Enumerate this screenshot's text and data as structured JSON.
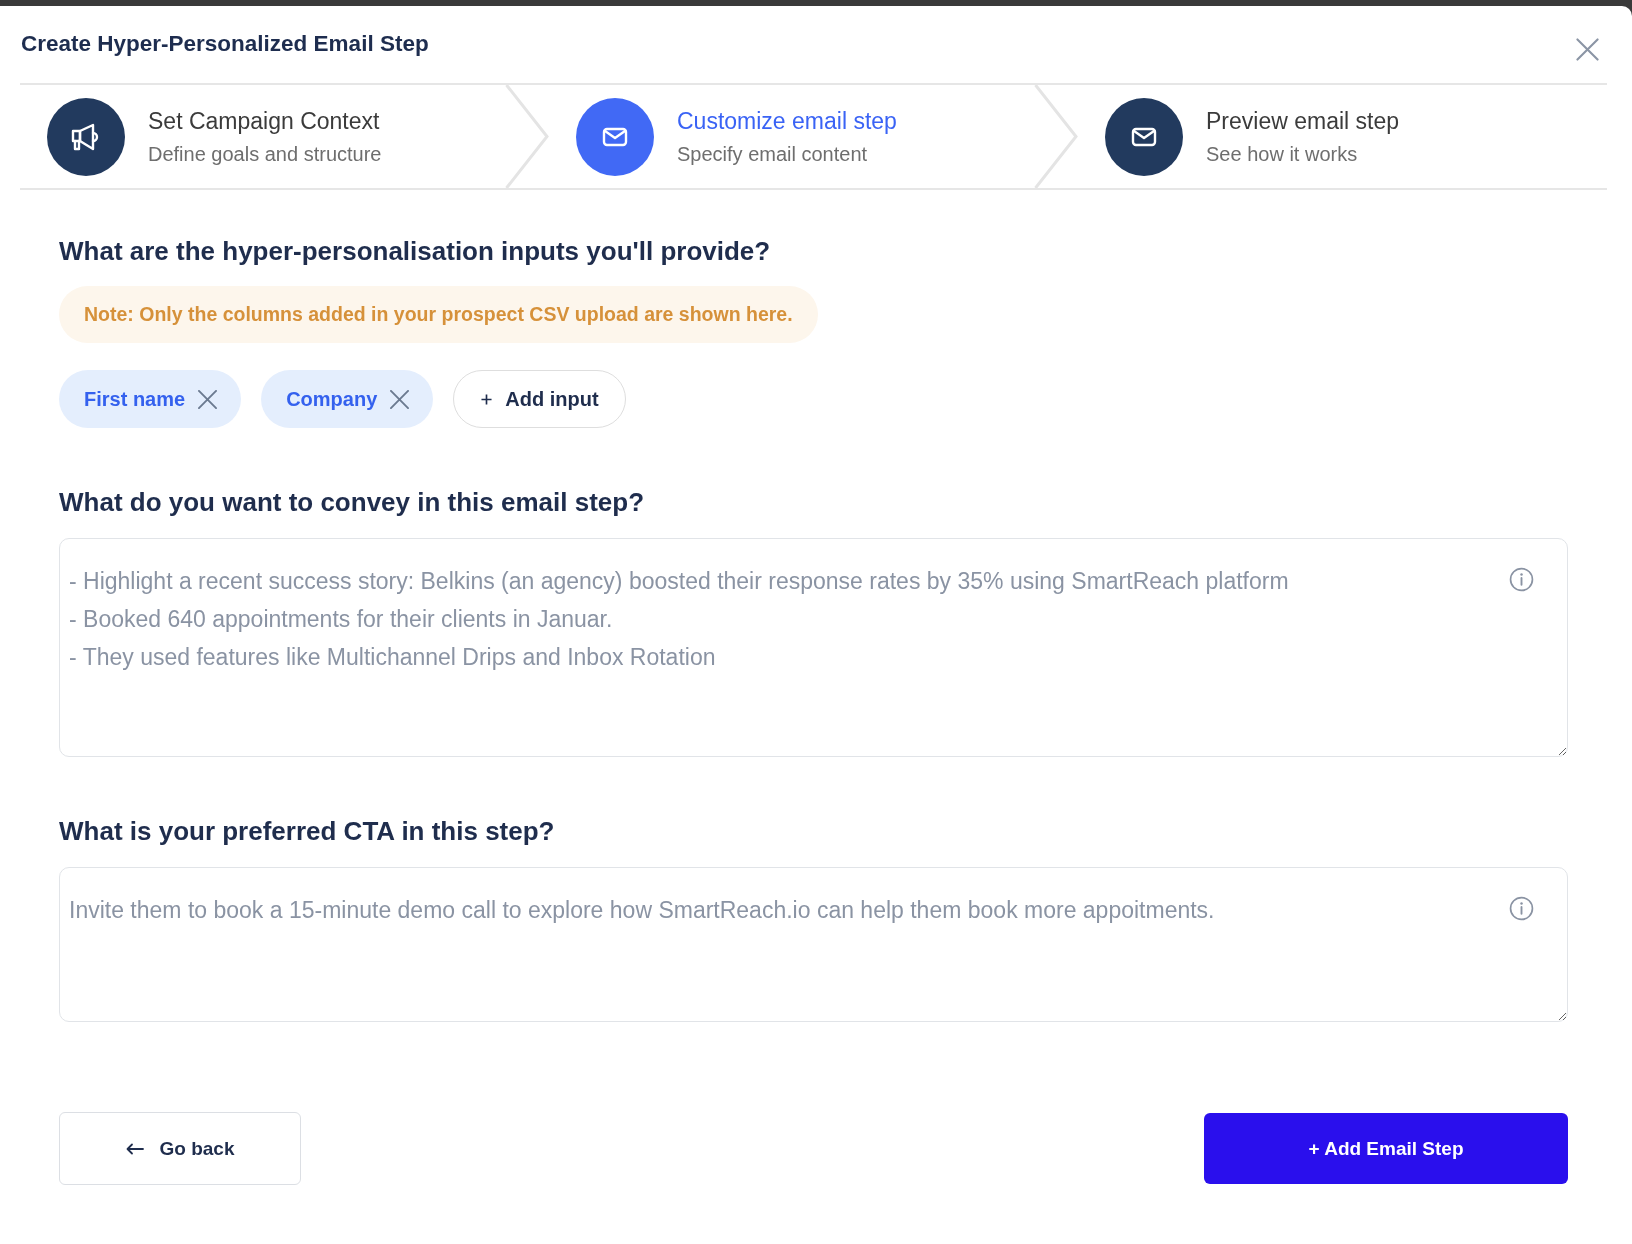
{
  "modal": {
    "title": "Create Hyper-Personalized Email Step"
  },
  "steps": [
    {
      "title": "Set Campaign Context",
      "subtitle": "Define goals and structure",
      "selected": false
    },
    {
      "title": "Customize email step",
      "subtitle": "Specify email content",
      "selected": true
    },
    {
      "title": "Preview email step",
      "subtitle": "See how it works",
      "selected": false
    }
  ],
  "inputs_section": {
    "heading": "What are the hyper-personalisation inputs you'll provide?",
    "note": "Note: Only the columns added in your prospect CSV upload are shown here.",
    "inputs": [
      {
        "label": "First name"
      },
      {
        "label": "Company"
      }
    ],
    "add_button": "Add input"
  },
  "message_section": {
    "heading": "What do you want to convey in this email step?",
    "placeholder": "- Highlight a recent success story: Belkins (an agency) boosted their response rates by 35% using SmartReach platform\n- Booked 640 appointments for their clients in Januar.\n- They used features like Multichannel Drips and Inbox Rotation"
  },
  "cta_section": {
    "heading": "What is your preferred CTA in this step?",
    "placeholder": "Invite them to book a 15-minute demo call to explore how SmartReach.io can help them book more appoitments."
  },
  "footer": {
    "back_button": "Go back",
    "submit_button": "+ Add Email Step"
  }
}
